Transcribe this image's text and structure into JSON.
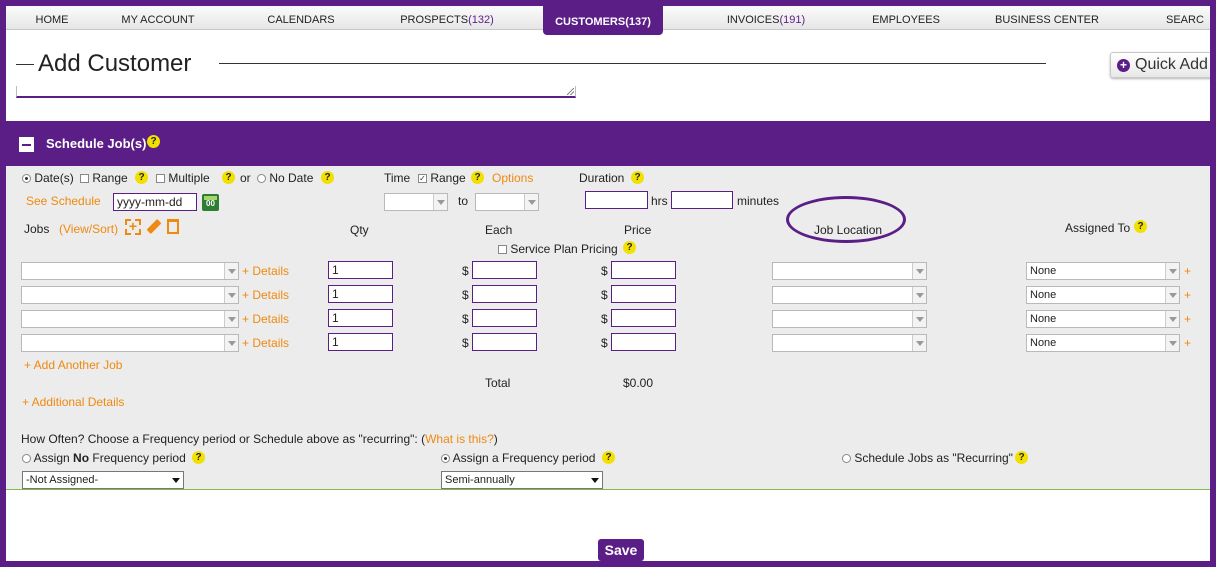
{
  "nav": {
    "items": [
      {
        "label": "HOME",
        "count": ""
      },
      {
        "label": "MY ACCOUNT",
        "count": ""
      },
      {
        "label": "CALENDARS",
        "count": ""
      },
      {
        "label": "PROSPECTS",
        "count": "(132)"
      },
      {
        "label": "CUSTOMERS",
        "count": "(137)"
      },
      {
        "label": "INVOICES",
        "count": "(191)"
      },
      {
        "label": "EMPLOYEES",
        "count": ""
      },
      {
        "label": "BUSINESS CENTER",
        "count": ""
      },
      {
        "label": "SEARC",
        "count": ""
      }
    ],
    "active": "CUSTOMERS"
  },
  "page": {
    "title": "Add Customer",
    "quick_add_label": "Quick Add",
    "save_label": "Save"
  },
  "section": {
    "title": "Schedule Job(s)",
    "help_glyph": "?"
  },
  "schedule": {
    "dates_label": "Date(s)",
    "range_label": "Range",
    "multiple_label": "Multiple",
    "or_label": "or",
    "no_date_label": "No Date",
    "see_schedule_label": "See Schedule",
    "date_placeholder": "yyyy-mm-dd",
    "calendar_glyph": "00",
    "time_label": "Time",
    "time_range_label": "Range",
    "options_label": "Options",
    "to_label": "to",
    "duration_label": "Duration",
    "hrs_label": "hrs",
    "minutes_label": "minutes",
    "dates_selected": true,
    "time_range_checked": true
  },
  "jobs": {
    "jobs_header": "Jobs",
    "view_sort_label": "(View/Sort)",
    "qty_header": "Qty",
    "each_header": "Each",
    "price_header": "Price",
    "service_plan_label": "Service Plan Pricing",
    "job_location_header": "Job Location",
    "assigned_to_header": "Assigned To",
    "details_label": "+ Details",
    "currency": "$",
    "plus": "+",
    "rows": [
      {
        "qty": "1",
        "assigned": "None"
      },
      {
        "qty": "1",
        "assigned": "None"
      },
      {
        "qty": "1",
        "assigned": "None"
      },
      {
        "qty": "1",
        "assigned": "None"
      }
    ],
    "add_another_label": "+ Add Another Job",
    "total_label": "Total",
    "total_value": "$0.00",
    "additional_details_label": "+ Additional Details"
  },
  "frequency": {
    "prompt": "How Often? Choose a Frequency period or Schedule above as \"recurring\": (",
    "what_is_this": "What is this?",
    "prompt_end": ")",
    "assign_prefix": "Assign ",
    "assign_bold": "No",
    "assign_suffix": " Frequency period",
    "assign_freq_label": "Assign a Frequency period",
    "schedule_recurring_label": "Schedule Jobs as \"Recurring\"",
    "not_assigned_value": "-Not Assigned-",
    "frequency_value": "Semi-annually",
    "selected": "assign_frequency"
  },
  "colors": {
    "brand": "#5a1e86",
    "accent": "#f0890f",
    "help": "#f1e000"
  }
}
